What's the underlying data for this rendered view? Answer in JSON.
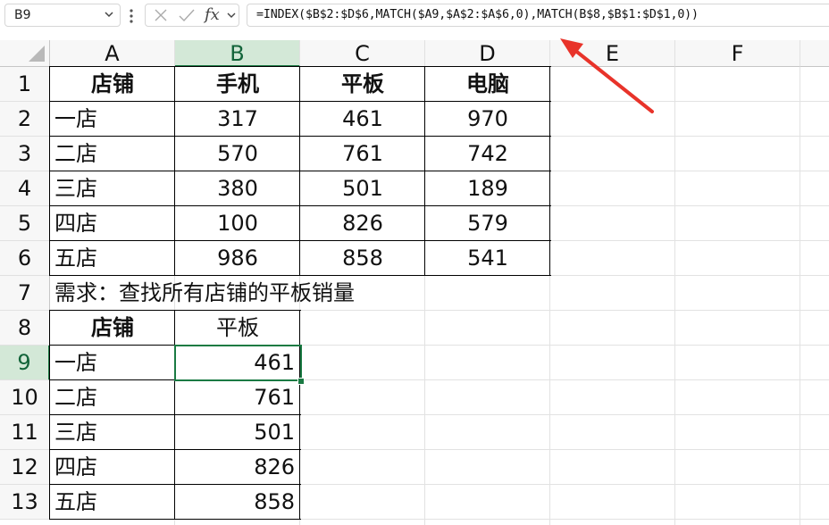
{
  "formula_bar": {
    "name_box": "B9",
    "fx_label": "fx",
    "formula": "=INDEX($B$2:$D$6,MATCH($A9,$A$2:$A$6,0),MATCH(B$8,$B$1:$D$1,0))"
  },
  "columns": [
    "A",
    "B",
    "C",
    "D",
    "E",
    "F"
  ],
  "rows": [
    "1",
    "2",
    "3",
    "4",
    "5",
    "6",
    "7",
    "8",
    "9",
    "10",
    "11",
    "12",
    "13"
  ],
  "table1": {
    "headers": [
      "店铺",
      "手机",
      "平板",
      "电脑"
    ],
    "rows": [
      [
        "一店",
        "317",
        "461",
        "970"
      ],
      [
        "二店",
        "570",
        "761",
        "742"
      ],
      [
        "三店",
        "380",
        "501",
        "189"
      ],
      [
        "四店",
        "100",
        "826",
        "579"
      ],
      [
        "五店",
        "986",
        "858",
        "541"
      ]
    ]
  },
  "requirement_text": "需求：查找所有店铺的平板销量",
  "table2": {
    "headers": [
      "店铺",
      "平板"
    ],
    "rows": [
      [
        "一店",
        "461"
      ],
      [
        "二店",
        "761"
      ],
      [
        "三店",
        "501"
      ],
      [
        "四店",
        "826"
      ],
      [
        "五店",
        "858"
      ]
    ]
  },
  "colors": {
    "selection": "#1a7a43",
    "header_selected_bg": "#d3e8d7",
    "annotation_arrow": "#e8332a"
  }
}
